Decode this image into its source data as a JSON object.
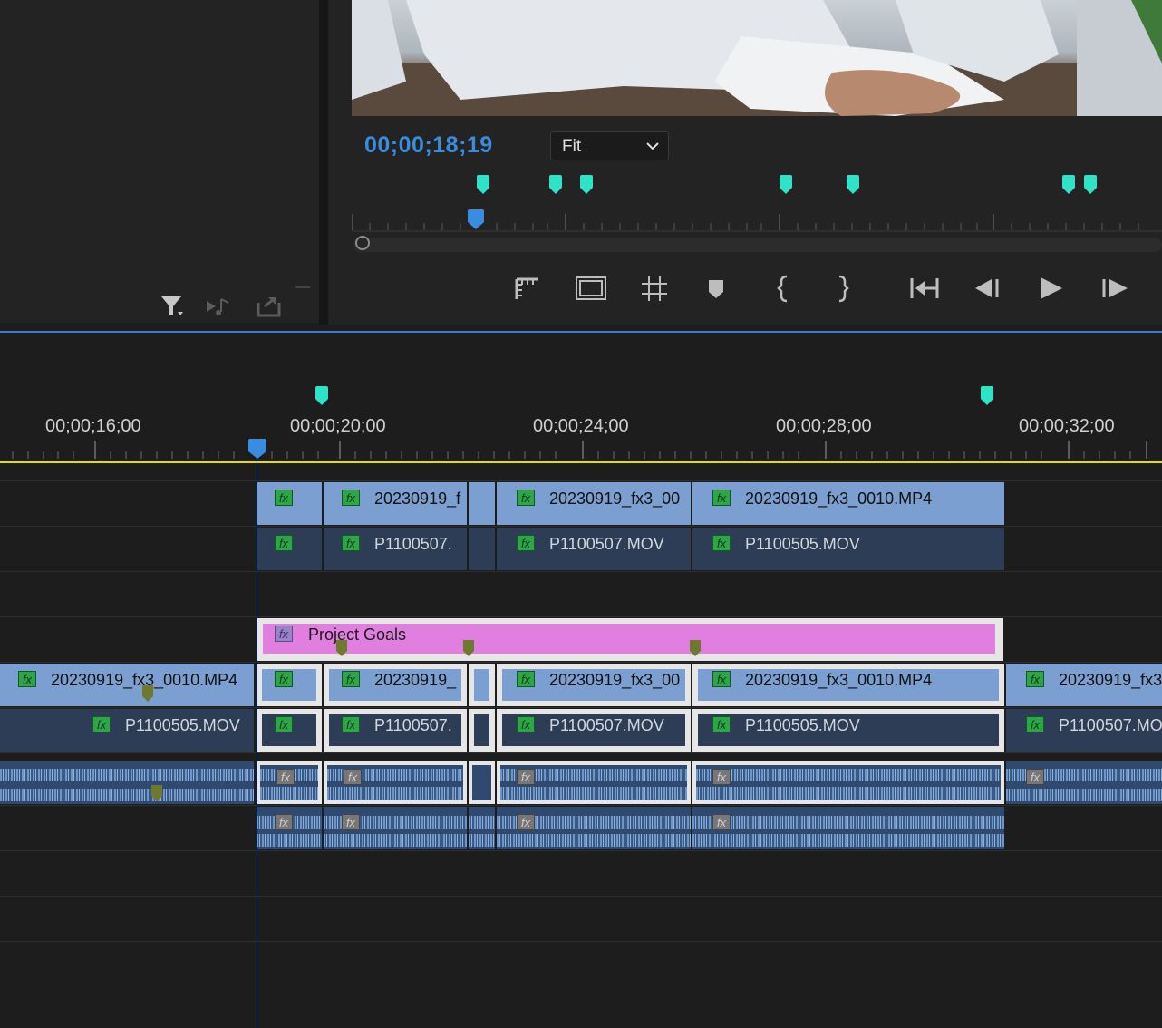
{
  "program_monitor": {
    "timecode": "00;00;18;19",
    "fit_select": {
      "value": "Fit"
    }
  },
  "timeline": {
    "ruler_labels": [
      "00;00;16;00",
      "00;00;20;00",
      "00;00;24;00",
      "00;00;28;00",
      "00;00;32;00"
    ],
    "v4_clips": [
      "20230919_f",
      "20230919_fx3_00",
      "20230919_fx3_0010.MP4"
    ],
    "v3_clips": [
      "P1100507.",
      "P1100507.MOV",
      "P1100505.MOV"
    ],
    "graphic_clip": "Project Goals",
    "v1_clips": [
      "20230919_fx3_0010.MP4",
      "20230919_",
      "20230919_fx3_00",
      "20230919_fx3_0010.MP4",
      "20230919_fx3"
    ],
    "v0_clips": [
      "P1100505.MOV",
      "P1100507.",
      "P1100507.MOV",
      "P1100505.MOV",
      "P1100507.MO"
    ]
  },
  "colors": {
    "timecode_blue": "#3a8dde",
    "marker_cyan": "#2fe3c7",
    "graphic_pink": "#e07fe0",
    "playbar_yellow": "#e8d72b"
  }
}
